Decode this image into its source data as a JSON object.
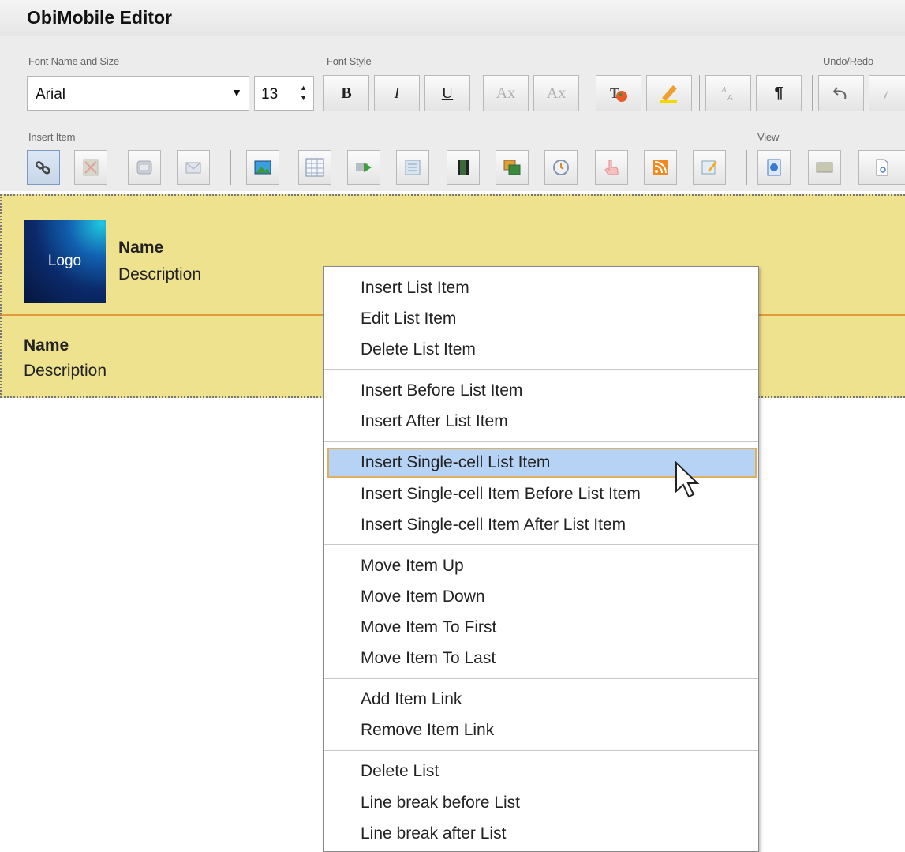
{
  "app": {
    "title": "ObiMobile Editor"
  },
  "toolbar": {
    "font_group_label": "Font Name and Size",
    "font_style_label": "Font Style",
    "undo_redo_label": "Undo/Redo",
    "insert_item_label": "Insert Item",
    "view_label": "View",
    "font_name": "Arial",
    "font_size": "13",
    "bold": "B",
    "italic": "I",
    "underline": "U",
    "subscript": "Ax",
    "superscript": "Ax",
    "paragraph": "¶"
  },
  "document": {
    "header": {
      "logo": "Logo",
      "name": "Name",
      "description": "Description"
    },
    "row": {
      "name": "Name",
      "description": "Description"
    }
  },
  "context_menu": {
    "items": [
      "Insert List Item",
      "Edit List Item",
      "Delete List Item",
      "Insert Before List Item",
      "Insert After List Item",
      "Insert Single-cell List Item",
      "Insert Single-cell Item Before List Item",
      "Insert Single-cell Item After List Item",
      "Move Item Up",
      "Move Item Down",
      "Move Item To First",
      "Move Item To Last",
      "Add Item Link",
      "Remove Item Link",
      "Delete List",
      "Line break before List",
      "Line break after List"
    ],
    "highlighted_index": 5
  },
  "colors": {
    "band": "#efe28f",
    "band_border": "#e09a3a",
    "highlight": "#b6d3f5"
  }
}
